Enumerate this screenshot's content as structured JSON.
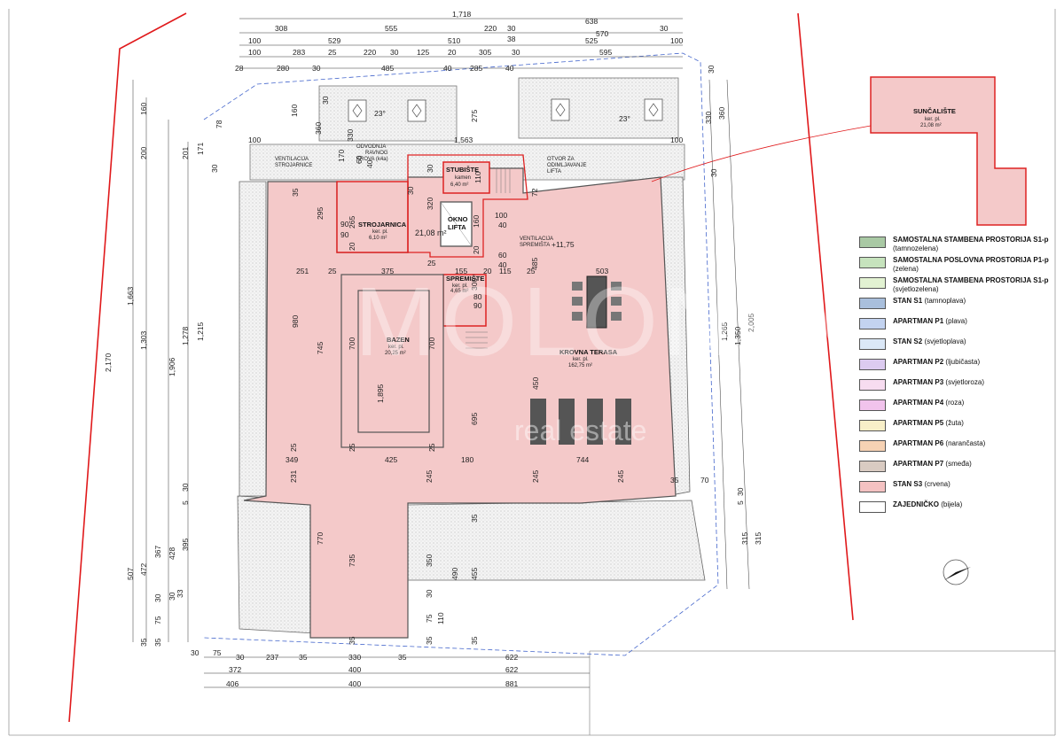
{
  "rooms": {
    "stubiste": {
      "name": "STUBIŠTE",
      "sub": "kamen",
      "area": "6,40 m²"
    },
    "strojarnica": {
      "name": "STROJARNICA",
      "sub": "ker. pl.",
      "area": "6,10 m²"
    },
    "okno": {
      "line1": "OKNO",
      "line2": "LIFTA"
    },
    "hall": {
      "area": "21,08 m²"
    },
    "spremiste": {
      "name": "SPREMIŠTE",
      "sub": "ker. pl.",
      "area": "4,65 m²"
    },
    "bazen": {
      "name": "BAZEN",
      "sub": "ker. pl.",
      "area": "20,25 m²"
    },
    "terasa": {
      "name": "KROVNA TERASA",
      "sub": "ker. pl.",
      "area": "162,75 m²"
    },
    "suncaliste": {
      "name": "SUNČALIŠTE",
      "sub": "ker. pl.",
      "area": "21,08 m²"
    }
  },
  "notes": {
    "vent_strojarnice": [
      "VENTILACIJA",
      "STROJARNICE"
    ],
    "odvodnja": [
      "ODVODNJA",
      "RAVNOG",
      "KROVA (k4a)"
    ],
    "otvor": [
      "OTVOR ZA",
      "ODIMLJAVANJE",
      "LIFTA"
    ],
    "vent_spremista": [
      "VENTILACIJA",
      "SPREMIŠTA"
    ],
    "level": "+11,75",
    "slope": "23°"
  },
  "dims_top": [
    {
      "text": "1,718"
    },
    {
      "text": "638"
    },
    {
      "text": "308"
    },
    {
      "text": "555"
    },
    {
      "text": "220"
    },
    {
      "text": "30"
    },
    {
      "text": "570"
    },
    {
      "text": "30"
    },
    {
      "text": "100"
    },
    {
      "text": "529"
    },
    {
      "text": "510"
    },
    {
      "text": "38"
    },
    {
      "text": "525"
    },
    {
      "text": "100"
    },
    {
      "text": "100"
    },
    {
      "text": "283"
    },
    {
      "text": "25"
    },
    {
      "text": "220"
    },
    {
      "text": "30"
    },
    {
      "text": "125"
    },
    {
      "text": "20"
    },
    {
      "text": "305"
    },
    {
      "text": "30"
    },
    {
      "text": "595"
    },
    {
      "text": "28"
    },
    {
      "text": "280"
    },
    {
      "text": "30"
    },
    {
      "text": "485"
    },
    {
      "text": "40"
    },
    {
      "text": "285"
    },
    {
      "text": "40"
    }
  ],
  "dims_bottom": [
    {
      "text": "30"
    },
    {
      "text": "75"
    },
    {
      "text": "30"
    },
    {
      "text": "237"
    },
    {
      "text": "35"
    },
    {
      "text": "330"
    },
    {
      "text": "35"
    },
    {
      "text": "622"
    },
    {
      "text": "372"
    },
    {
      "text": "400"
    },
    {
      "text": "622"
    },
    {
      "text": "406"
    },
    {
      "text": "400"
    },
    {
      "text": "881"
    }
  ],
  "dims_left": [
    {
      "text": "2,170"
    },
    {
      "text": "1,663"
    },
    {
      "text": "1,303"
    },
    {
      "text": "1,906"
    },
    {
      "text": "1,278"
    },
    {
      "text": "1,215"
    },
    {
      "text": "160"
    },
    {
      "text": "200"
    },
    {
      "text": "201"
    },
    {
      "text": "78"
    },
    {
      "text": "171"
    },
    {
      "text": "30"
    },
    {
      "text": "30"
    },
    {
      "text": "507"
    },
    {
      "text": "472"
    },
    {
      "text": "367"
    },
    {
      "text": "428"
    },
    {
      "text": "395"
    },
    {
      "text": "30"
    },
    {
      "text": "5"
    },
    {
      "text": "30"
    },
    {
      "text": "75"
    },
    {
      "text": "35"
    },
    {
      "text": "35"
    },
    {
      "text": "33"
    }
  ],
  "dims_right": [
    {
      "text": "360"
    },
    {
      "text": "330"
    },
    {
      "text": "30"
    },
    {
      "text": "2,005"
    },
    {
      "text": "1,350"
    },
    {
      "text": "1,265"
    },
    {
      "text": "30"
    },
    {
      "text": "70"
    },
    {
      "text": "5"
    },
    {
      "text": "315"
    },
    {
      "text": "315"
    },
    {
      "text": "30"
    }
  ],
  "dims_inner": [
    {
      "text": "100"
    },
    {
      "text": "1,563"
    },
    {
      "text": "100"
    },
    {
      "text": "330"
    },
    {
      "text": "30"
    },
    {
      "text": "160"
    },
    {
      "text": "360"
    },
    {
      "text": "275"
    },
    {
      "text": "170"
    },
    {
      "text": "60"
    },
    {
      "text": "40"
    },
    {
      "text": "30"
    },
    {
      "text": "110"
    },
    {
      "text": "72"
    },
    {
      "text": "35"
    },
    {
      "text": "295"
    },
    {
      "text": "90"
    },
    {
      "text": "90"
    },
    {
      "text": "265"
    },
    {
      "text": "20"
    },
    {
      "text": "30"
    },
    {
      "text": "320"
    },
    {
      "text": "160"
    },
    {
      "text": "20"
    },
    {
      "text": "100"
    },
    {
      "text": "40"
    },
    {
      "text": "60"
    },
    {
      "text": "40"
    },
    {
      "text": "251"
    },
    {
      "text": "25"
    },
    {
      "text": "375"
    },
    {
      "text": "25"
    },
    {
      "text": "155"
    },
    {
      "text": "20"
    },
    {
      "text": "115"
    },
    {
      "text": "25"
    },
    {
      "text": "503"
    },
    {
      "text": "485"
    },
    {
      "text": "80"
    },
    {
      "text": "90"
    },
    {
      "text": "300"
    },
    {
      "text": "980"
    },
    {
      "text": "745"
    },
    {
      "text": "700"
    },
    {
      "text": "700"
    },
    {
      "text": "1,895"
    },
    {
      "text": "695"
    },
    {
      "text": "450"
    },
    {
      "text": "25"
    },
    {
      "text": "25"
    },
    {
      "text": "25"
    },
    {
      "text": "349"
    },
    {
      "text": "425"
    },
    {
      "text": "180"
    },
    {
      "text": "744"
    },
    {
      "text": "35"
    },
    {
      "text": "231"
    },
    {
      "text": "245"
    },
    {
      "text": "245"
    },
    {
      "text": "245"
    },
    {
      "text": "770"
    },
    {
      "text": "735"
    },
    {
      "text": "350"
    },
    {
      "text": "490"
    },
    {
      "text": "455"
    },
    {
      "text": "30"
    },
    {
      "text": "75"
    },
    {
      "text": "110"
    },
    {
      "text": "35"
    },
    {
      "text": "35"
    },
    {
      "text": "35"
    },
    {
      "text": "35"
    }
  ],
  "legend": [
    {
      "label": "SAMOSTALNA STAMBENA PROSTORIJA S1-p",
      "sub": "(tamnozelena)",
      "color": "#a9c9a4"
    },
    {
      "label": "SAMOSTALNA POSLOVNA PROSTORIJA P1-p",
      "sub": "(zelena)",
      "color": "#c6e3bd"
    },
    {
      "label": "SAMOSTALNA STAMBENA PROSTORIJA S1-p",
      "sub": "(svjetlozelena)",
      "color": "#e2f2d2"
    },
    {
      "label": "STAN S1",
      "sub": "(tamnoplava)",
      "color": "#a9bfdc"
    },
    {
      "label": "APARTMAN P1",
      "sub": "(plava)",
      "color": "#c3d3f0"
    },
    {
      "label": "STAN S2",
      "sub": "(svjetloplava)",
      "color": "#dbe8f7"
    },
    {
      "label": "APARTMAN P2",
      "sub": "(ljubičasta)",
      "color": "#dccbf0"
    },
    {
      "label": "APARTMAN P3",
      "sub": "(svjetloroza)",
      "color": "#f7dcf0"
    },
    {
      "label": "APARTMAN P4",
      "sub": "(roza)",
      "color": "#f1c3ec"
    },
    {
      "label": "APARTMAN P5",
      "sub": "(žuta)",
      "color": "#f8efc8"
    },
    {
      "label": "APARTMAN P6",
      "sub": "(narančasta)",
      "color": "#f6d2b4"
    },
    {
      "label": "APARTMAN P7",
      "sub": "(smeđa)",
      "color": "#d9cbc2"
    },
    {
      "label": "STAN S3",
      "sub": "(crvena)",
      "color": "#f4c2c2"
    },
    {
      "label": "ZAJEDNIČKO",
      "sub": "(bijela)",
      "color": "#ffffff"
    }
  ],
  "watermark": {
    "main": "MOLONGO",
    "sub": "real estate"
  },
  "colors": {
    "zone": "#f4c9c9",
    "zone_stroke": "#d22",
    "wall": "#666",
    "hatch": "#dcdcdc",
    "boundary": "#e0191b"
  }
}
